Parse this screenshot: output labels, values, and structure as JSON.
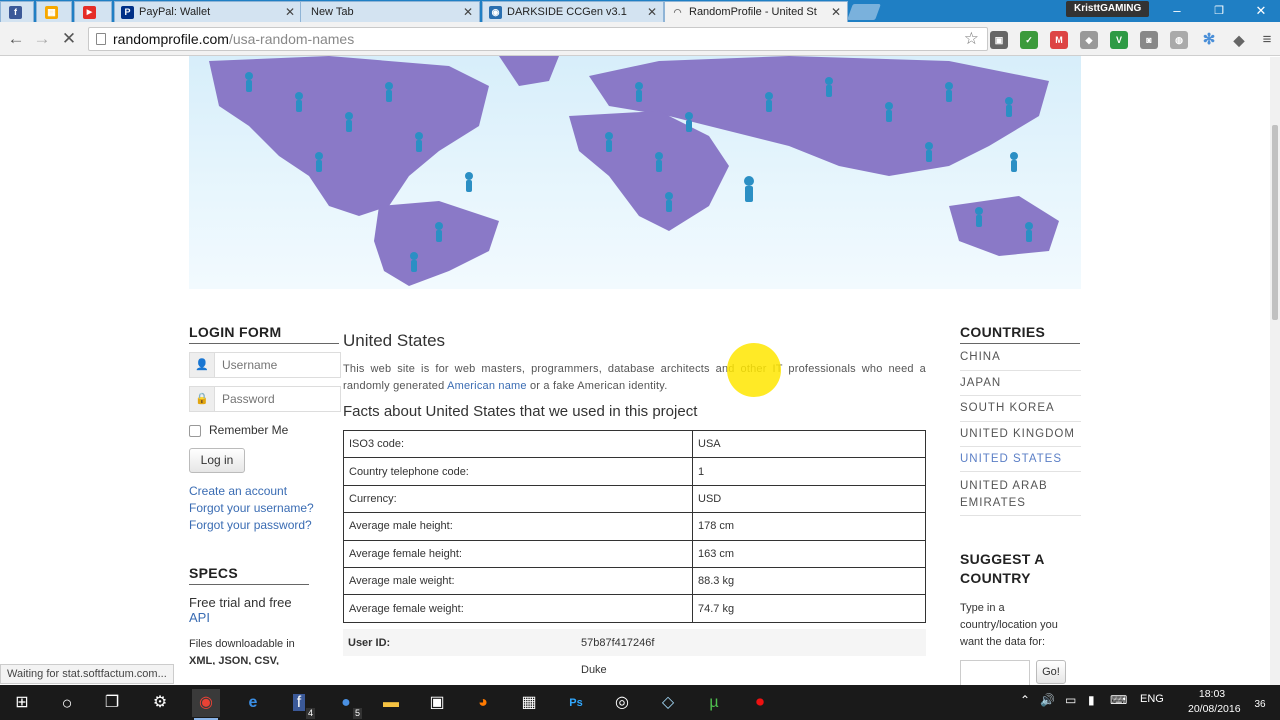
{
  "browser": {
    "tabs": [
      {
        "title": "",
        "favicon_color": "#3b5998",
        "favicon_glyph": "f"
      },
      {
        "title": "",
        "favicon_color": "#f6a800",
        "favicon_glyph": "▦"
      },
      {
        "title": "",
        "favicon_color": "#e52d27",
        "favicon_glyph": "▶"
      },
      {
        "title": "PayPal: Wallet",
        "favicon_color": "#003087",
        "favicon_glyph": "P"
      },
      {
        "title": "New Tab",
        "favicon_color": "#d3e3f1",
        "favicon_glyph": ""
      },
      {
        "title": "DARKSIDE CCGen v3.1",
        "favicon_color": "#2a6fb0",
        "favicon_glyph": "◉"
      },
      {
        "title": "RandomProfile - United St",
        "favicon_color": "#f2f2f2",
        "favicon_glyph": ""
      }
    ],
    "profile_name": "KristtGAMING",
    "url_host": "randomprofile.com",
    "url_path": "/usa-random-names"
  },
  "login": {
    "title": "LOGIN FORM",
    "username_placeholder": "Username",
    "password_placeholder": "Password",
    "remember_label": "Remember Me",
    "login_button": "Log in",
    "links": [
      "Create an account",
      "Forgot your username?",
      "Forgot your password?"
    ]
  },
  "specs": {
    "title": "SPECS",
    "line1": "Free trial and free",
    "line1_link": "API",
    "line2": "Files downloadable in",
    "line3": "XML, JSON, CSV,"
  },
  "main": {
    "heading": "United States",
    "intro_before": "This web site is for web masters, programmers, database architects and other IT professionals who need a randomly generated ",
    "intro_link": "American name",
    "intro_after": " or a fake American identity.",
    "facts_heading": "Facts about United States that we used in this project",
    "facts": [
      {
        "label": "ISO3 code:",
        "value": "USA"
      },
      {
        "label": "Country telephone code:",
        "value": "1"
      },
      {
        "label": "Currency:",
        "value": "USD"
      },
      {
        "label": "Average male height:",
        "value": "178 cm"
      },
      {
        "label": "Average female height:",
        "value": "163 cm"
      },
      {
        "label": "Average male weight:",
        "value": "88.3 kg"
      },
      {
        "label": "Average female weight:",
        "value": "74.7 kg"
      }
    ],
    "user_id_label": "User ID:",
    "user_id_value": "57b87f417246f",
    "next_value": "Duke"
  },
  "countries": {
    "title": "COUNTRIES",
    "items": [
      "CHINA",
      "JAPAN",
      "SOUTH KOREA",
      "UNITED KINGDOM",
      "UNITED STATES",
      "UNITED ARAB EMIRATES"
    ],
    "active": "UNITED STATES"
  },
  "suggest": {
    "title": "SUGGEST A COUNTRY",
    "text": "Type in a country/location you want the data for:",
    "button": "Go!"
  },
  "status_text": "Waiting for stat.softfactum.com...",
  "taskbar": {
    "badges": {
      "folder_app": "4",
      "messenger": "5"
    },
    "lang": "ENG",
    "time": "18:03",
    "date": "20/08/2016",
    "notifications": "36"
  }
}
